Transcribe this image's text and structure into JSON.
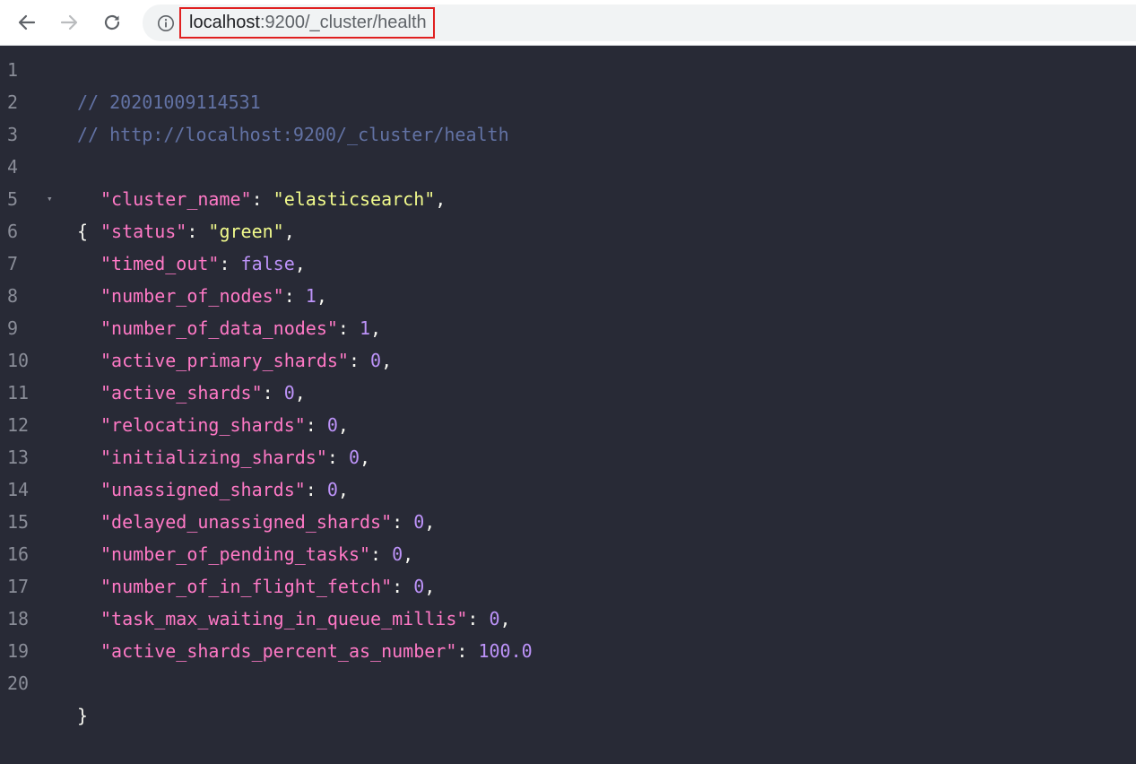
{
  "browser": {
    "url_host": "localhost",
    "url_path": ":9200/_cluster/health",
    "icons": {
      "back": "arrow-left-icon",
      "forward": "arrow-right-icon",
      "reload": "reload-icon",
      "info": "info-icon"
    },
    "colors": {
      "highlight_border": "#e02020"
    }
  },
  "editor": {
    "line_numbers": [
      "1",
      "2",
      "3",
      "4",
      "5",
      "6",
      "7",
      "8",
      "9",
      "10",
      "11",
      "12",
      "13",
      "14",
      "15",
      "16",
      "17",
      "18",
      "19",
      "20"
    ],
    "fold_marker": "▾",
    "comment_timestamp": "// 20201009114531",
    "comment_url": "// http://localhost:9200/_cluster/health",
    "open_brace": "{",
    "close_brace": "}",
    "fields": [
      {
        "key": "\"cluster_name\"",
        "value": "\"elasticsearch\"",
        "type": "str",
        "comma": ","
      },
      {
        "key": "\"status\"",
        "value": "\"green\"",
        "type": "str",
        "comma": ","
      },
      {
        "key": "\"timed_out\"",
        "value": "false",
        "type": "bool",
        "comma": ","
      },
      {
        "key": "\"number_of_nodes\"",
        "value": "1",
        "type": "num",
        "comma": ","
      },
      {
        "key": "\"number_of_data_nodes\"",
        "value": "1",
        "type": "num",
        "comma": ","
      },
      {
        "key": "\"active_primary_shards\"",
        "value": "0",
        "type": "num",
        "comma": ","
      },
      {
        "key": "\"active_shards\"",
        "value": "0",
        "type": "num",
        "comma": ","
      },
      {
        "key": "\"relocating_shards\"",
        "value": "0",
        "type": "num",
        "comma": ","
      },
      {
        "key": "\"initializing_shards\"",
        "value": "0",
        "type": "num",
        "comma": ","
      },
      {
        "key": "\"unassigned_shards\"",
        "value": "0",
        "type": "num",
        "comma": ","
      },
      {
        "key": "\"delayed_unassigned_shards\"",
        "value": "0",
        "type": "num",
        "comma": ","
      },
      {
        "key": "\"number_of_pending_tasks\"",
        "value": "0",
        "type": "num",
        "comma": ","
      },
      {
        "key": "\"number_of_in_flight_fetch\"",
        "value": "0",
        "type": "num",
        "comma": ","
      },
      {
        "key": "\"task_max_waiting_in_queue_millis\"",
        "value": "0",
        "type": "num",
        "comma": ","
      },
      {
        "key": "\"active_shards_percent_as_number\"",
        "value": "100.0",
        "type": "num",
        "comma": ""
      }
    ],
    "colors": {
      "background": "#282a36",
      "comment": "#6272a4",
      "key": "#ff79c6",
      "string": "#f1fa8c",
      "number": "#bd93f9"
    }
  }
}
